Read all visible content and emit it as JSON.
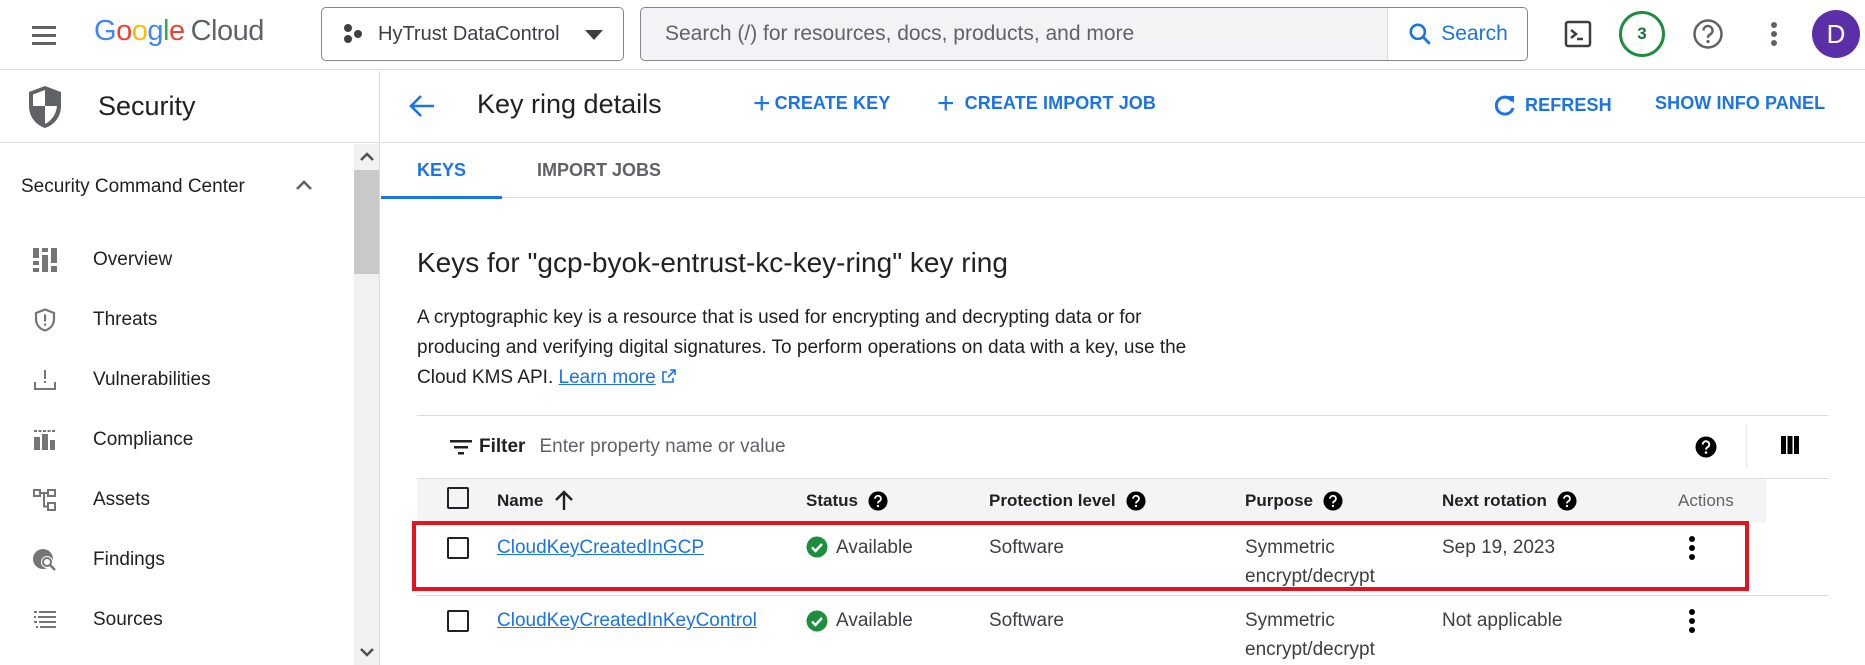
{
  "topbar": {
    "logo_google": [
      "G",
      "o",
      "o",
      "g",
      "l",
      "e"
    ],
    "logo_cloud": "Cloud",
    "project_name": "HyTrust DataControl",
    "search_placeholder": "Search (/) for resources, docs, products, and more",
    "search_button": "Search",
    "notifications_count": "3",
    "avatar_initial": "D"
  },
  "sidebar": {
    "title": "Security",
    "section_title": "Security Command Center",
    "items": [
      {
        "label": "Overview",
        "icon": "dashboard-icon"
      },
      {
        "label": "Threats",
        "icon": "shield-alert-icon"
      },
      {
        "label": "Vulnerabilities",
        "icon": "vulnerability-icon"
      },
      {
        "label": "Compliance",
        "icon": "compliance-icon"
      },
      {
        "label": "Assets",
        "icon": "assets-icon"
      },
      {
        "label": "Findings",
        "icon": "findings-icon"
      },
      {
        "label": "Sources",
        "icon": "sources-icon"
      }
    ]
  },
  "header": {
    "title": "Key ring details",
    "create_key": "CREATE KEY",
    "create_import_job": "CREATE IMPORT JOB",
    "refresh": "REFRESH",
    "show_info_panel": "SHOW INFO PANEL"
  },
  "tabs": [
    {
      "label": "KEYS",
      "active": true
    },
    {
      "label": "IMPORT JOBS",
      "active": false
    }
  ],
  "content": {
    "heading": "Keys for \"gcp-byok-entrust-kc-key-ring\" key ring",
    "description": "A cryptographic key is a resource that is used for encrypting and decrypting data or for producing and verifying digital signatures. To perform operations on data with a key, use the Cloud KMS API.",
    "learn_more": "Learn more"
  },
  "filter": {
    "label": "Filter",
    "placeholder": "Enter property name or value"
  },
  "table": {
    "columns": [
      "Name",
      "Status",
      "Protection level",
      "Purpose",
      "Next rotation",
      "Actions"
    ],
    "rows": [
      {
        "name": "CloudKeyCreatedInGCP",
        "status": "Available",
        "protection": "Software",
        "purpose_line1": "Symmetric",
        "purpose_line2": "encrypt/decrypt",
        "next_rotation": "Sep 19, 2023",
        "highlighted": true
      },
      {
        "name": "CloudKeyCreatedInKeyControl",
        "status": "Available",
        "protection": "Software",
        "purpose_line1": "Symmetric",
        "purpose_line2": "encrypt/decrypt",
        "next_rotation": "Not applicable",
        "highlighted": false
      }
    ]
  },
  "colors": {
    "accent": "#1a73e8",
    "status_ok": "#1e8e3e",
    "highlight_box": "#e3141e",
    "avatar_bg": "#5b2fa8"
  }
}
